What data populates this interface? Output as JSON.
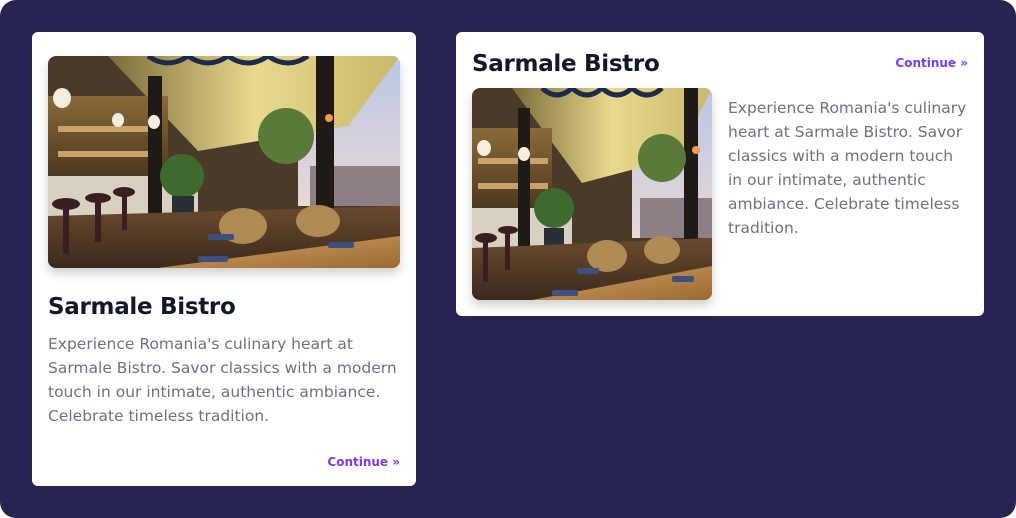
{
  "colors": {
    "background": "#262450",
    "card": "#ffffff",
    "title": "#111827",
    "description": "#6b7280",
    "link": "#7c3aed"
  },
  "cards": [
    {
      "layout": "vertical",
      "title": "Sarmale Bistro",
      "description": "Experience Romania's culinary heart at Sarmale Bistro. Savor classics with a modern touch in our intimate, authentic ambiance. Celebrate timeless tradition.",
      "link_label": "Continue »",
      "image": "restaurant-interior-photo"
    },
    {
      "layout": "horizontal",
      "title": "Sarmale Bistro",
      "description": "Experience Romania's culinary heart at Sarmale Bistro. Savor classics with a modern touch in our intimate, authentic ambiance. Celebrate timeless tradition.",
      "link_label": "Continue »",
      "image": "restaurant-interior-photo"
    }
  ]
}
